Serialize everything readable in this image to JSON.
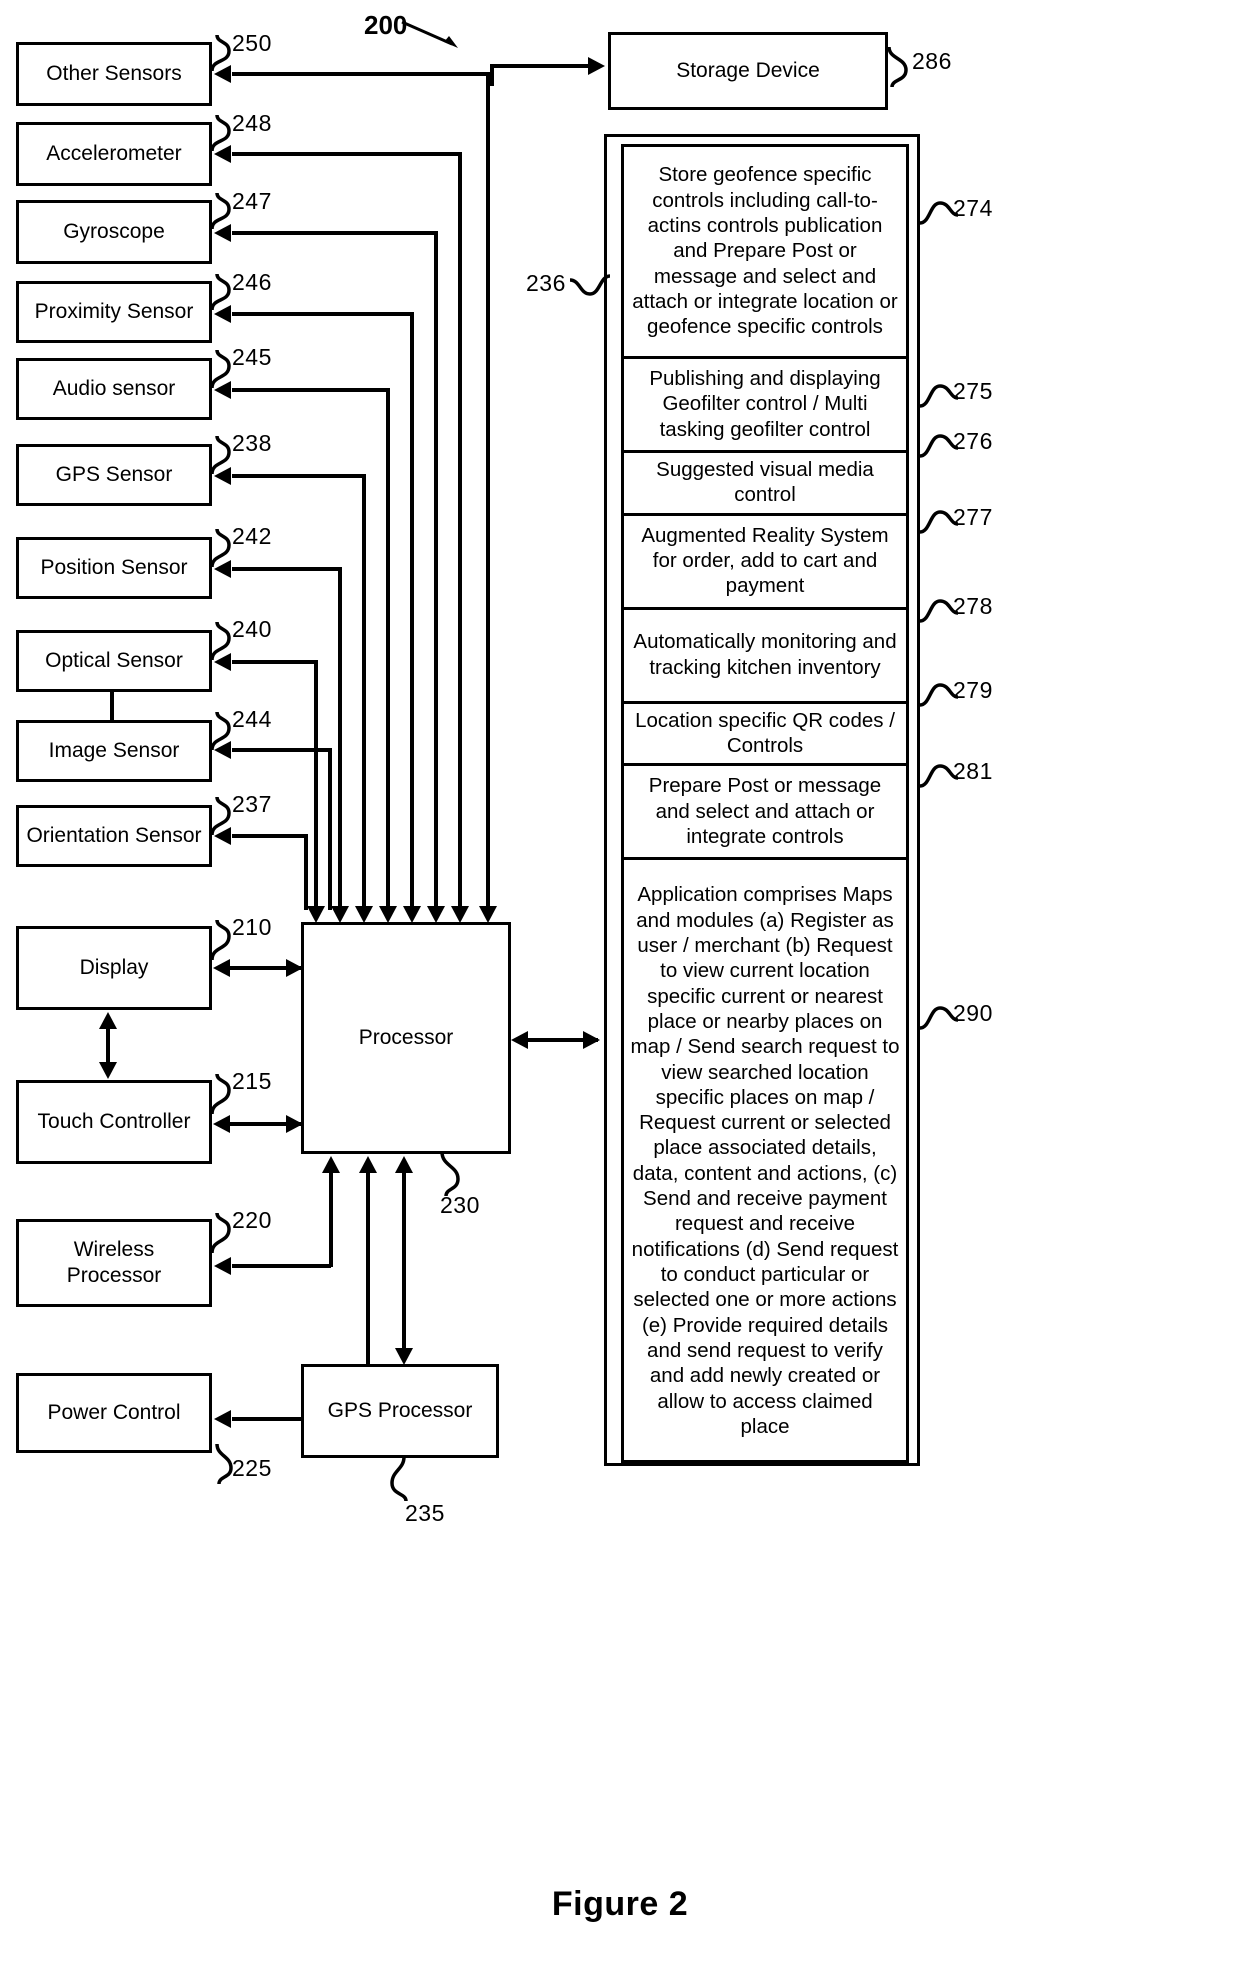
{
  "figure": {
    "caption": "Figure 2",
    "diagram_number": "200"
  },
  "left_blocks": [
    {
      "label": "Other Sensors",
      "ref": "250"
    },
    {
      "label": "Accelerometer",
      "ref": "248"
    },
    {
      "label": "Gyroscope",
      "ref": "247"
    },
    {
      "label": "Proximity Sensor",
      "ref": "246"
    },
    {
      "label": "Audio sensor",
      "ref": "245"
    },
    {
      "label": "GPS Sensor",
      "ref": "238"
    },
    {
      "label": "Position Sensor",
      "ref": "242"
    },
    {
      "label": "Optical Sensor",
      "ref": "240"
    },
    {
      "label": "Image Sensor",
      "ref": "244"
    },
    {
      "label": "Orientation Sensor",
      "ref": "237"
    },
    {
      "label": "Display",
      "ref": "210"
    },
    {
      "label": "Touch Controller",
      "ref": "215"
    },
    {
      "label": "Wireless Processor",
      "ref": "220"
    },
    {
      "label": "Power Control",
      "ref": "225"
    }
  ],
  "center": {
    "processor_label": "Processor",
    "processor_ref": "230",
    "gps_processor_label": "GPS Processor",
    "gps_processor_ref": "235"
  },
  "right": {
    "storage_label": "Storage Device",
    "storage_ref": "286",
    "stack_ref": "236",
    "modules": [
      {
        "text": "Store geofence specific controls including call-to-actins controls publication and Prepare Post or message and select and attach or integrate location or geofence specific controls",
        "ref": "274"
      },
      {
        "text": "Publishing and displaying Geofilter control / Multi tasking geofilter control",
        "ref": "275"
      },
      {
        "text": "Suggested visual media control",
        "ref": "276"
      },
      {
        "text": "Augmented Reality System for order, add to cart and payment",
        "ref": "277"
      },
      {
        "text": "Automatically monitoring and tracking kitchen inventory",
        "ref": "278"
      },
      {
        "text": "Location specific QR codes / Controls",
        "ref": "279"
      },
      {
        "text": "Prepare Post or message and select and attach or integrate controls",
        "ref": "281"
      },
      {
        "text": "Application comprises Maps and modules (a) Register as user / merchant (b) Request to view current location specific current or nearest place or nearby places on map / Send search request to view searched location specific places on map / Request current or selected place  associated details, data, content and actions, (c) Send and receive payment request and receive notifications (d) Send request to conduct particular or selected one or more actions (e) Provide required details and send request to verify and add newly created  or allow to access claimed place",
        "ref": "290"
      }
    ]
  }
}
